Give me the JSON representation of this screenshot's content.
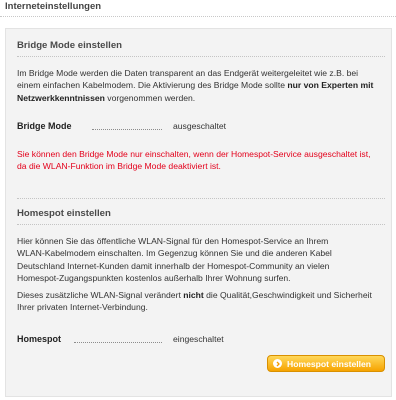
{
  "header": {
    "title": "Interneteinstellungen"
  },
  "bridge": {
    "title": "Bridge Mode einstellen",
    "desc_lines": [
      "Im Bridge Mode werden die Daten transparent an das Endgerät weitergeleitet wie z.B. bei",
      "einem einfachen Kabelmodem. Die Aktivierung des Bridge Mode sollte "
    ],
    "desc_bold_1": "nur von Experten mit",
    "desc_bold_2": "Netzwerkkenntnissen",
    "desc_tail": " vorgenommen werden.",
    "status_label": "Bridge Mode",
    "status_value": "ausgeschaltet",
    "warning_lines": [
      "Sie können den Bridge Mode nur einschalten, wenn der Homespot-Service ausgeschaltet ist,",
      "da die WLAN-Funktion im Bridge Mode deaktiviert ist."
    ]
  },
  "homespot": {
    "title": "Homespot einstellen",
    "desc_lines": [
      "Hier können Sie das öffentliche WLAN-Signal für den Homespot-Service an Ihrem",
      "WLAN-Kabelmodem einschalten. Im Gegenzug können Sie und die anderen Kabel",
      "Deutschland Internet-Kunden damit innerhalb der Homespot-Community an vielen",
      "Homespot-Zugangspunkten kostenlos außerhalb Ihrer Wohnung surfen."
    ],
    "info_pre": "Dieses zusätzliche WLAN-Signal verändert ",
    "info_bold": "nicht",
    "info_post": " die Qualität,Geschwindigkeit und Sicherheit",
    "info_line2": "Ihrer privaten Internet-Verbindung.",
    "status_label": "Homespot",
    "status_value": "eingeschaltet",
    "button_label": "Homespot einstellen",
    "button_icon": "chevron-right-icon"
  },
  "colors": {
    "warning": "#e3001b",
    "button_top": "#ffd85a",
    "button_bottom": "#f6a300",
    "panel_bg": "#f3f3f3"
  }
}
